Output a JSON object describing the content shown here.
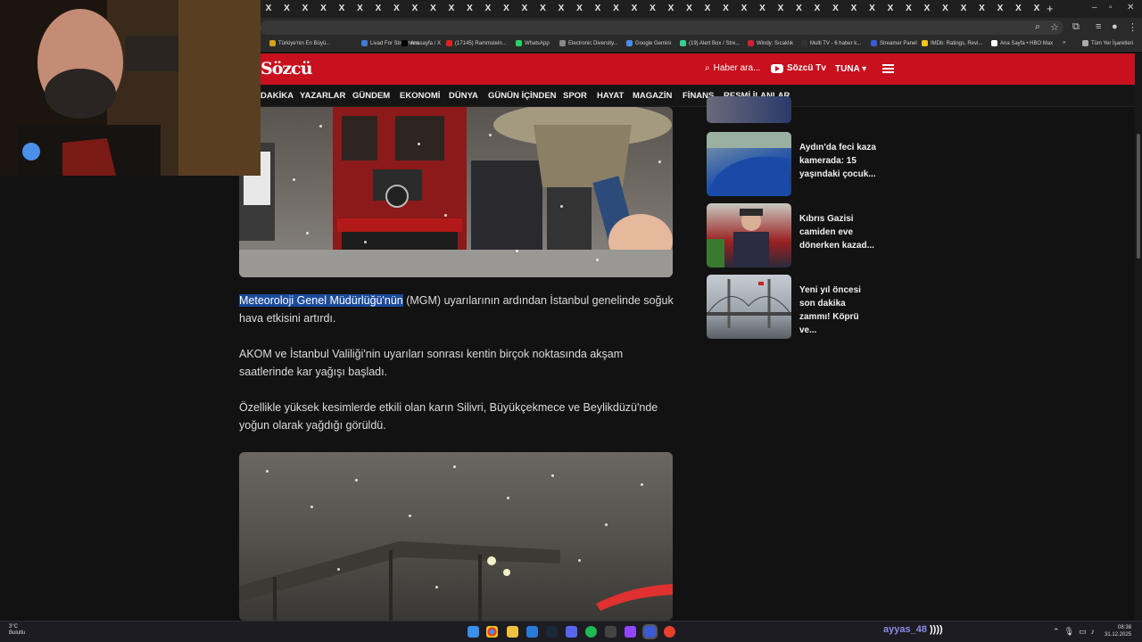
{
  "browser": {
    "tab_glyph": "X",
    "new_tab": "+",
    "minimize": "–",
    "maximize": "▫",
    "close": "✕"
  },
  "bookmarks": [
    {
      "label": "Türkiye'nin En Büyü...",
      "color": "#d4a017"
    },
    {
      "label": "Livad For Streamers",
      "color": "#3a7bd5"
    },
    {
      "label": "Anasayfa / X",
      "color": "#000000"
    },
    {
      "label": "(17145) Rammstein...",
      "color": "#e02020"
    },
    {
      "label": "WhatsApp",
      "color": "#25d366"
    },
    {
      "label": "Electronic Diversity...",
      "color": "#888888"
    },
    {
      "label": "Google Gemini",
      "color": "#4a8cf0"
    },
    {
      "label": "(19) Alert Box / Stre...",
      "color": "#3ccf8e"
    },
    {
      "label": "Windy: Sıcaklık",
      "color": "#c23"
    },
    {
      "label": "Multi TV - 6 haber k...",
      "color": "#333333"
    },
    {
      "label": "Streamer Panel",
      "color": "#3a5bd5"
    },
    {
      "label": "IMDb: Ratings, Revi...",
      "color": "#f5c518"
    },
    {
      "label": "Ana Sayfa • HBO Max",
      "color": "#ffffff"
    },
    {
      "label": "»",
      "color": ""
    },
    {
      "label": "Tüm Yer İşaretleri",
      "color": "#aaaaaa"
    }
  ],
  "site": {
    "logo": "Sözcü",
    "search_placeholder": "Haber ara...",
    "tv_label": "Sözcü Tv",
    "user_label": "TUNA ▾"
  },
  "nav": [
    "DAKİKA",
    "YAZARLAR",
    "GÜNDEM",
    "EKONOMİ",
    "DÜNYA",
    "GÜNÜN İÇİNDEN",
    "SPOR",
    "HAYAT",
    "MAGAZİN",
    "FİNANS",
    "RESMİ İLANLAR"
  ],
  "article": {
    "p1_highlight": "Meteoroloji Genel Müdürlüğü'nün",
    "p1_rest": " (MGM) uyarılarının ardından İstanbul genelinde soğuk hava etkisini artırdı.",
    "p2": "AKOM ve İstanbul Valiliği'nin uyarıları sonrası kentin birçok noktasında akşam saatlerinde kar yağışı başladı.",
    "p3": "Özellikle yüksek kesimlerde etkili olan karın Silivri, Büyükçekmece ve Beylikdüzü'nde yoğun olarak yağdığı görüldü."
  },
  "sidebar": [
    {
      "title": "Aydın'da feci kaza kamerada: 15 yaşındaki çocuk..."
    },
    {
      "title": "Kıbrıs Gazisi camiden eve dönerken kazad..."
    },
    {
      "title": "Yeni yıl öncesi son dakika zammı! Köprü ve..."
    }
  ],
  "taskbar": {
    "temp": "3°C",
    "weather": "Bulutlu",
    "streamer": "ayyas_48",
    "streamer_suffix": "))))",
    "time": "08:38",
    "date": "31.12.2025"
  }
}
